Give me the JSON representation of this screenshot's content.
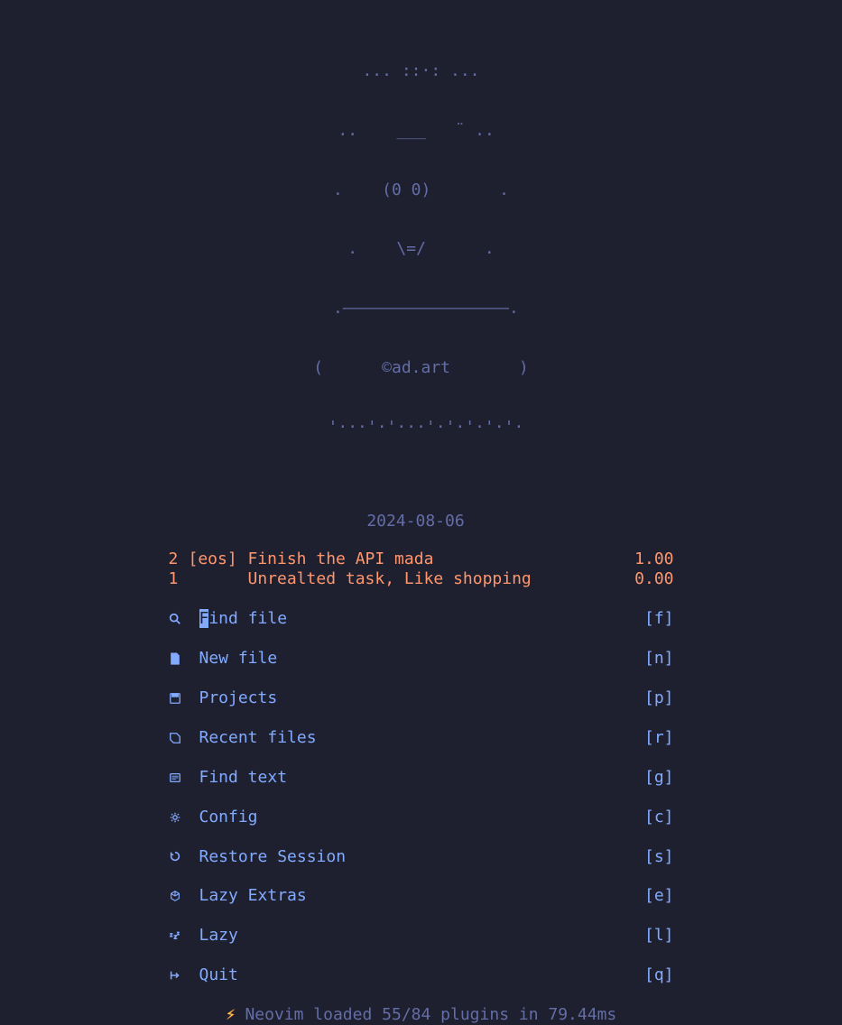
{
  "ascii_art": {
    "line1": "... ::·: ...",
    "line2": " ..    ___   ¨ ..  ",
    "line3": ".    (0 0)       .",
    "line4": " .    \\=/      . ",
    "line5": " .—————————————————.",
    "line6": "(      ©ad.art       )",
    "line7": " '···'·'···'·'·'·'·'·"
  },
  "date": "2024-08-06",
  "tasks": [
    {
      "num": "2",
      "tag": "[eos]",
      "desc": "Finish the API mada",
      "score": "1.00"
    },
    {
      "num": "1",
      "tag": "",
      "desc": "Unrealted task, Like shopping",
      "score": "0.00"
    }
  ],
  "menu": [
    {
      "icon": "search",
      "label_first": "F",
      "label_rest": "ind file",
      "key": "[f]",
      "selected": true
    },
    {
      "icon": "file",
      "label": "New file",
      "key": "[n]"
    },
    {
      "icon": "save",
      "label": "Projects",
      "key": "[p]"
    },
    {
      "icon": "recent",
      "label": "Recent files",
      "key": "[r]"
    },
    {
      "icon": "text",
      "label": "Find text",
      "key": "[g]"
    },
    {
      "icon": "gear",
      "label": "Config",
      "key": "[c]"
    },
    {
      "icon": "restore",
      "label": "Restore Session",
      "key": "[s]"
    },
    {
      "icon": "cube",
      "label": "Lazy Extras",
      "key": "[e]"
    },
    {
      "icon": "sleep",
      "label": "Lazy",
      "key": "[l]"
    },
    {
      "icon": "exit",
      "label": "Quit",
      "key": "[q]"
    }
  ],
  "footer": {
    "bolt": "⚡",
    "text": "Neovim loaded 55/84 plugins in 79.44ms"
  }
}
